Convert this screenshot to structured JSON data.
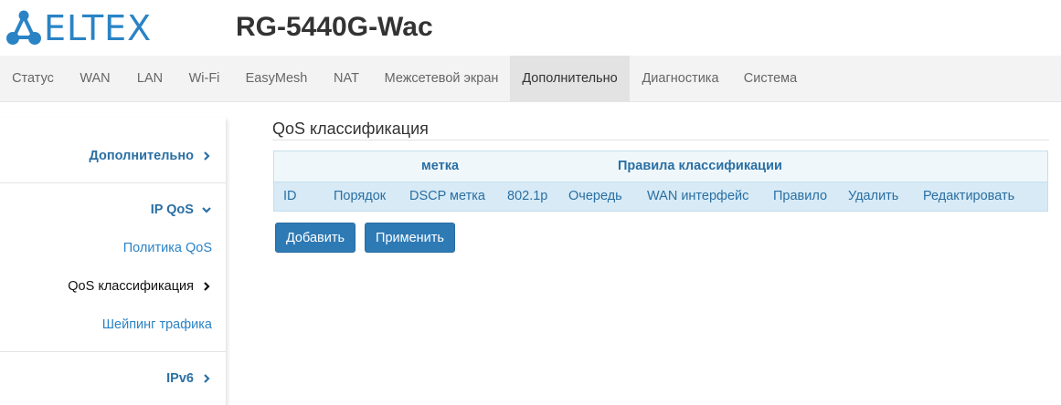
{
  "header": {
    "logo_text": "ELTEX",
    "model": "RG-5440G-Wac",
    "brand_color": "#2a83c5"
  },
  "topnav": {
    "items": [
      {
        "label": "Статус"
      },
      {
        "label": "WAN"
      },
      {
        "label": "LAN"
      },
      {
        "label": "Wi-Fi"
      },
      {
        "label": "EasyMesh"
      },
      {
        "label": "NAT"
      },
      {
        "label": "Межсетевой экран"
      },
      {
        "label": "Дополнительно",
        "active": true
      },
      {
        "label": "Диагностика"
      },
      {
        "label": "Система"
      }
    ]
  },
  "sidebar": {
    "group1": {
      "label": "Дополнительно",
      "icon": "chevron-right-icon"
    },
    "group2": {
      "label": "IP QoS",
      "icon": "chevron-down-icon"
    },
    "subitems": [
      {
        "label": "Политика QoS"
      },
      {
        "label": "QoS классификация",
        "current": true,
        "icon": "chevron-right-icon"
      },
      {
        "label": "Шейпинг трафика"
      }
    ],
    "group3": {
      "label": "IPv6",
      "icon": "chevron-right-icon"
    }
  },
  "main": {
    "title": "QoS классификация",
    "table": {
      "group_headers": [
        "метка",
        "Правила классификации"
      ],
      "columns": [
        "ID",
        "Порядок",
        "DSCP метка",
        "802.1p",
        "Очередь",
        "WAN интерфейс",
        "Правило",
        "Удалить",
        "Редактировать"
      ],
      "rows": []
    },
    "buttons": {
      "add": "Добавить",
      "apply": "Применить"
    }
  }
}
